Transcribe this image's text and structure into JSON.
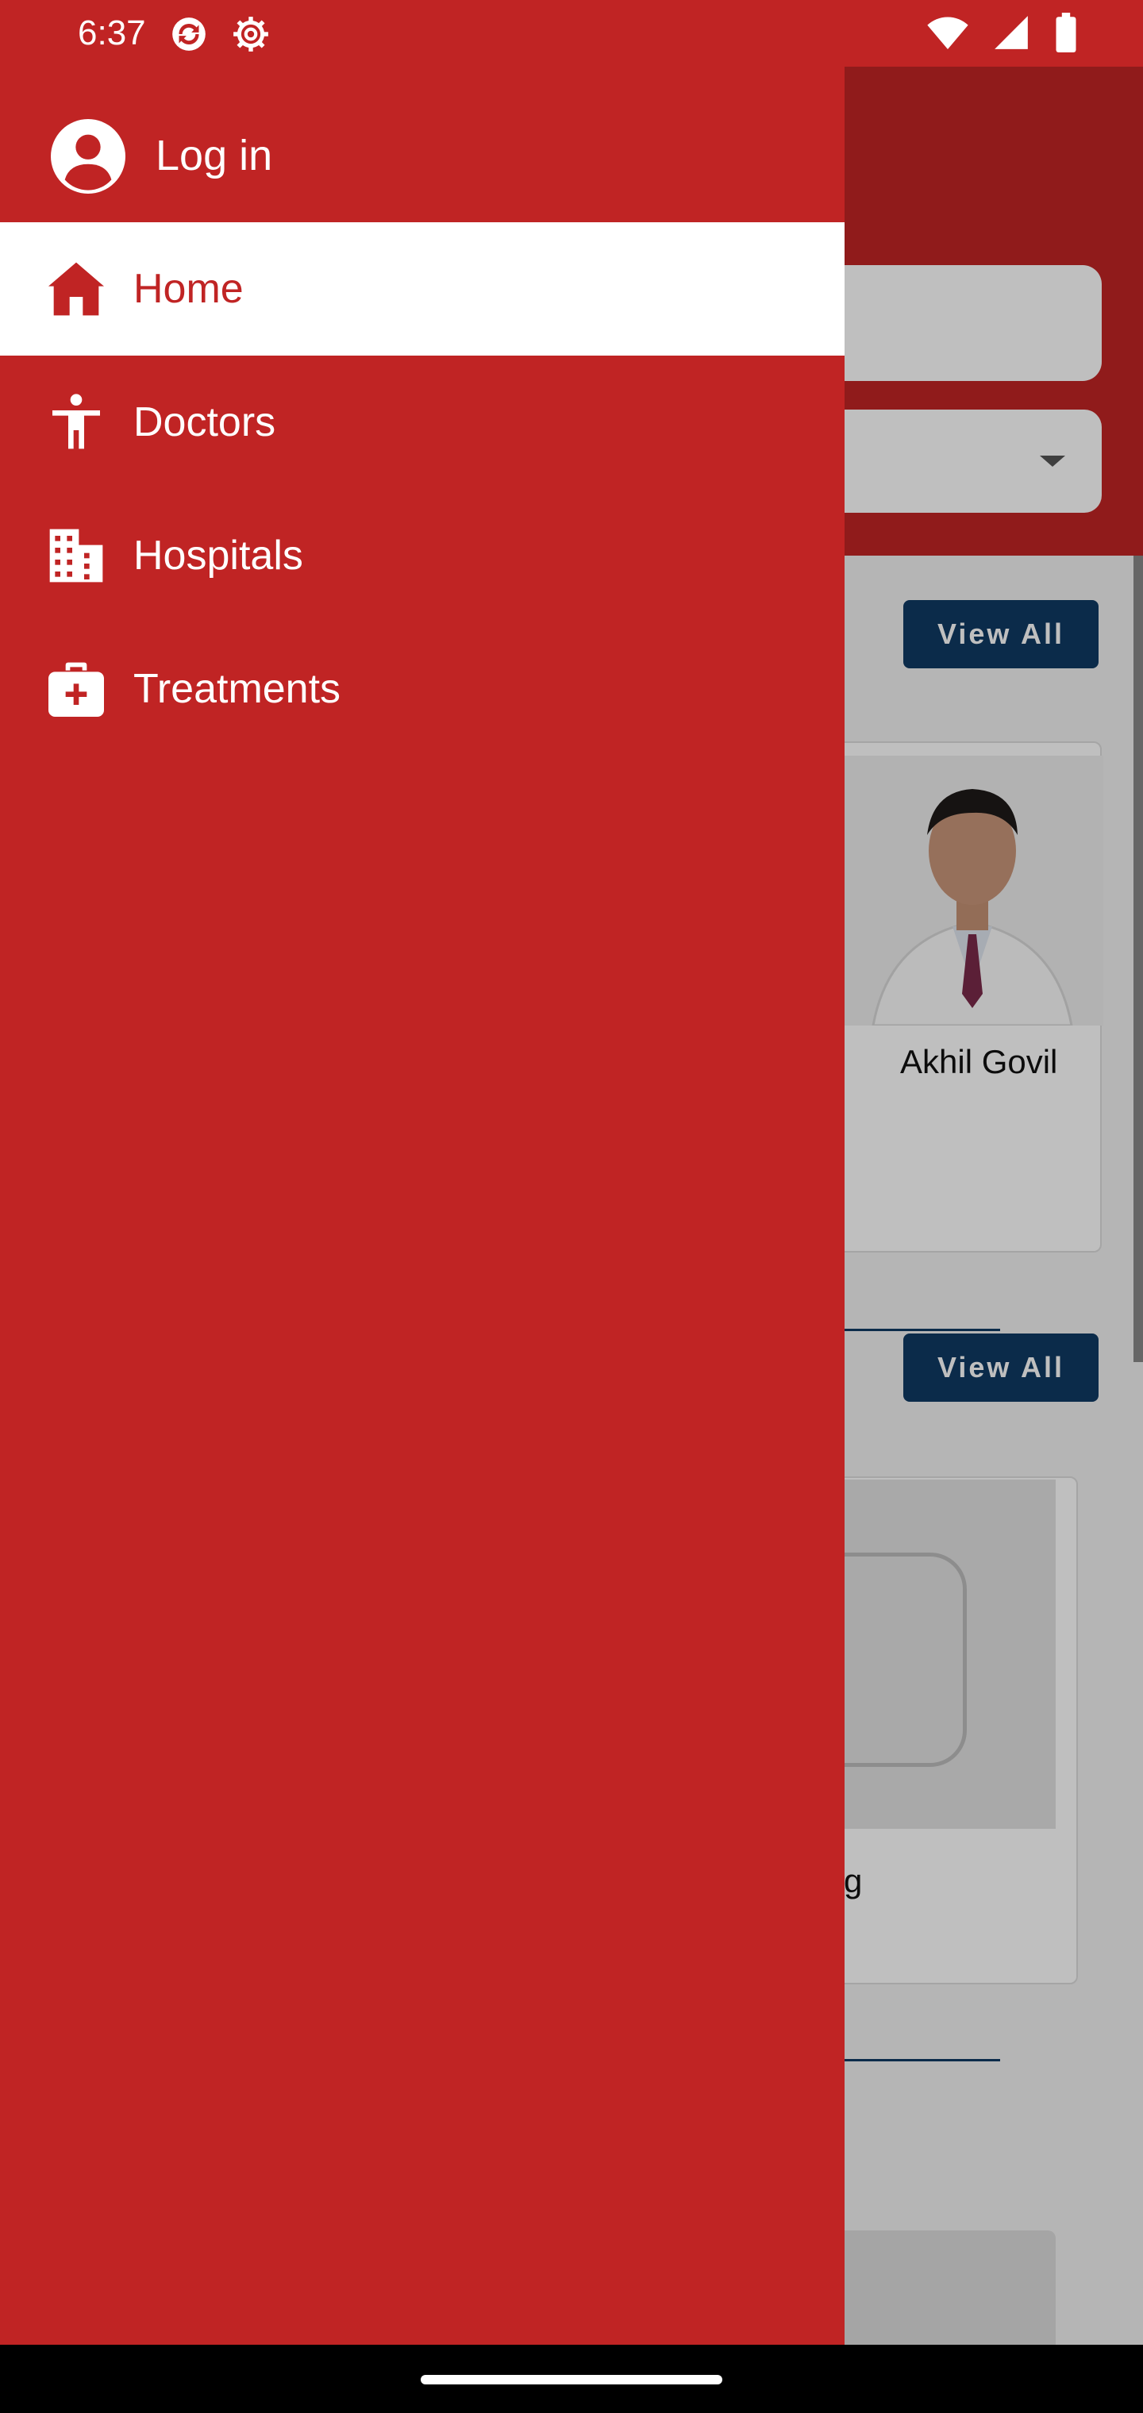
{
  "status_bar": {
    "time": "6:37",
    "left_icons": [
      "sync-icon",
      "settings-gear-icon"
    ],
    "right_icons": [
      "wifi-icon",
      "signal-icon",
      "battery-icon"
    ]
  },
  "drawer": {
    "login_label": "Log in",
    "items": [
      {
        "label": "Home",
        "icon": "home-icon",
        "active": true
      },
      {
        "label": "Doctors",
        "icon": "person-icon",
        "active": false
      },
      {
        "label": "Hospitals",
        "icon": "building-icon",
        "active": false
      },
      {
        "label": "Treatments",
        "icon": "medical-bag-icon",
        "active": false
      }
    ]
  },
  "background": {
    "view_all_label_1": "View All",
    "view_all_label_2": "View All",
    "doctor_name": "Akhil Govil",
    "hospital_name": "gVfg"
  },
  "colors": {
    "brand_red": "#c02424",
    "button_navy": "#0f3a63"
  }
}
